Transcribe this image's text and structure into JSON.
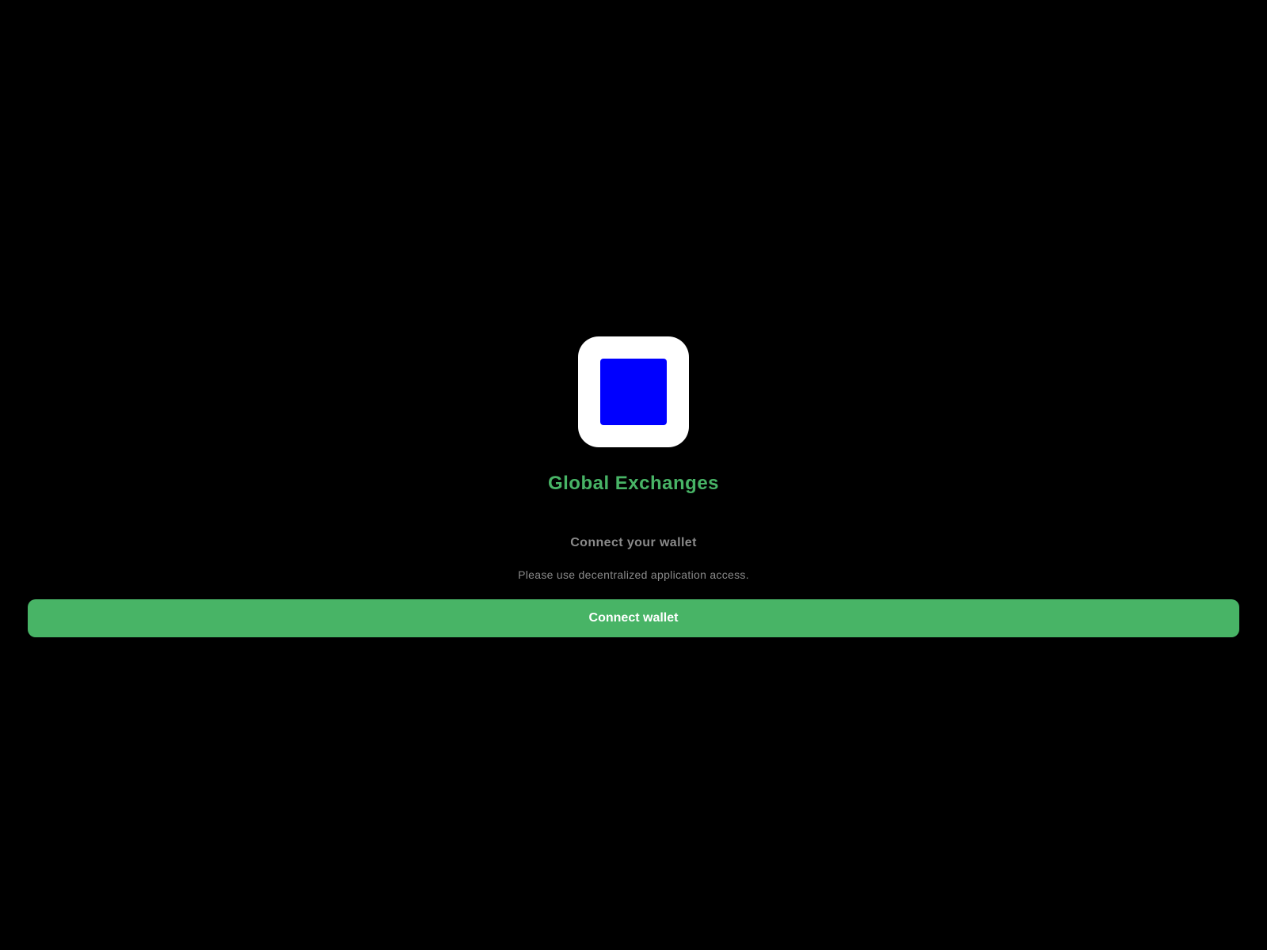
{
  "app": {
    "title": "Global Exchanges",
    "logo_icon": "blue-square-logo-icon"
  },
  "connect": {
    "heading": "Connect your wallet",
    "description": "Please use decentralized application access.",
    "button_label": "Connect wallet"
  },
  "colors": {
    "background": "#000000",
    "accent": "#48b466",
    "logo_tile": "#ffffff",
    "logo_square": "#0000ff",
    "muted_text": "#8a8a8a",
    "button_text": "#ffffff"
  }
}
